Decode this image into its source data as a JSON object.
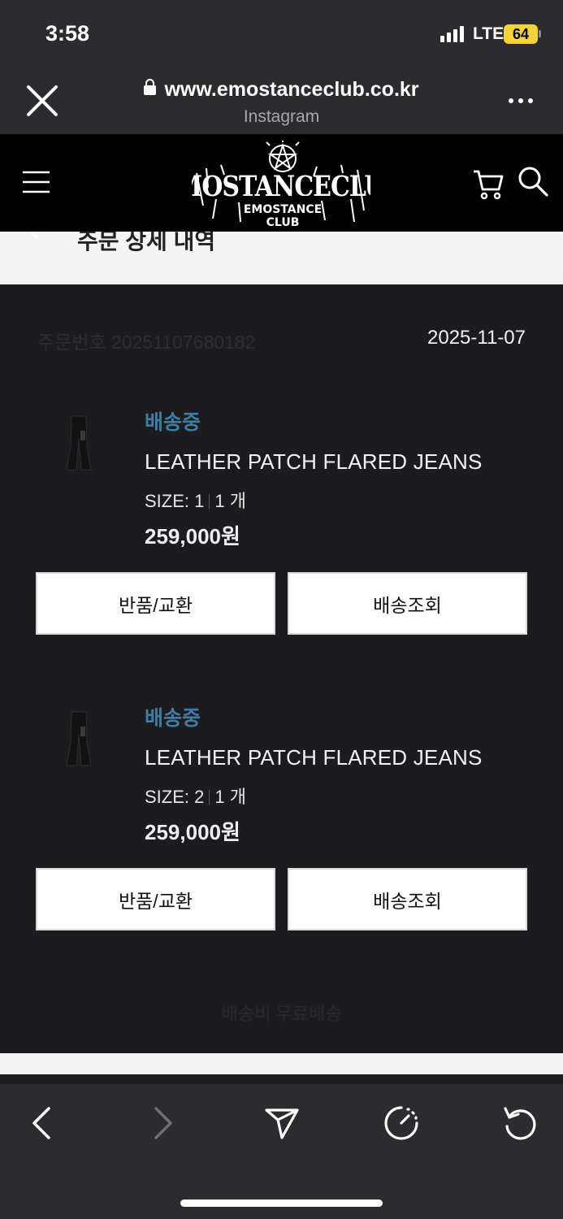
{
  "status_bar": {
    "time": "3:58",
    "network": "LTE",
    "battery": "64"
  },
  "browser": {
    "url": "www.emostanceclub.co.kr",
    "source": "Instagram"
  },
  "site": {
    "logo_lettering": "EMOSTANCECLUB EMOSTANCE CLUB"
  },
  "page": {
    "title": "주문 상세 내역"
  },
  "order": {
    "order_number": "주문번호 20251107680182",
    "date": "2025-11-07",
    "shipping_note": "배송비 무료배송",
    "items": [
      {
        "status": "배송중",
        "name": "LEATHER PATCH FLARED JEANS",
        "size": "SIZE: 1",
        "qty": "1 개",
        "price": "259,000원",
        "return_label": "반품/교환",
        "track_label": "배송조회"
      },
      {
        "status": "배송중",
        "name": "LEATHER PATCH FLARED JEANS",
        "size": "SIZE: 2",
        "qty": "1 개",
        "price": "259,000원",
        "return_label": "반품/교환",
        "track_label": "배송조회"
      }
    ]
  },
  "colors": {
    "status_blue": "#3d7ea6",
    "battery_yellow": "#f4d23c"
  }
}
